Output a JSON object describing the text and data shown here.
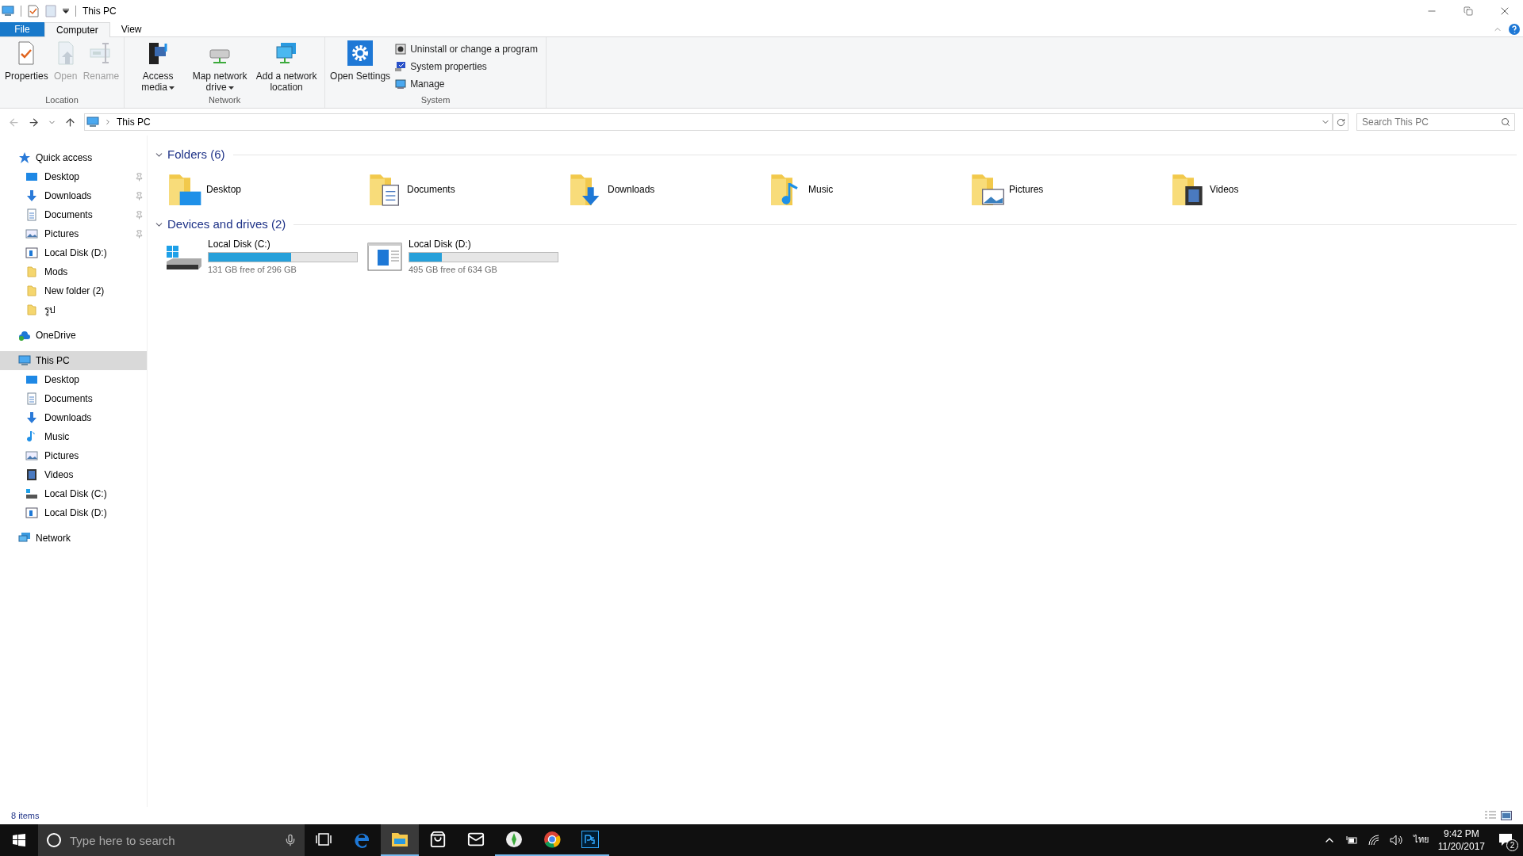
{
  "title_bar": {
    "title": "This PC"
  },
  "ribbon_tabs": [
    {
      "label": "File",
      "kind": "file",
      "selected": false
    },
    {
      "label": "Computer",
      "kind": "tab",
      "selected": true
    },
    {
      "label": "View",
      "kind": "tab",
      "selected": false
    }
  ],
  "ribbon_groups": [
    {
      "label": "Location",
      "items": [
        {
          "label": "Properties",
          "kind": "properties",
          "compact": false,
          "disabled": false,
          "dropdown": false
        },
        {
          "label": "Open",
          "kind": "open",
          "compact": false,
          "disabled": true,
          "dropdown": false
        },
        {
          "label": "Rename",
          "kind": "rename",
          "compact": false,
          "disabled": true,
          "dropdown": false
        }
      ]
    },
    {
      "label": "Network",
      "items": [
        {
          "label": "Access media",
          "kind": "media",
          "compact": false,
          "disabled": false,
          "dropdown": true
        },
        {
          "label": "Map network drive",
          "kind": "netdrive",
          "compact": false,
          "disabled": false,
          "dropdown": true
        },
        {
          "label": "Add a network location",
          "kind": "netloc",
          "compact": false,
          "disabled": false,
          "dropdown": false
        }
      ]
    },
    {
      "label": "System",
      "items": [
        {
          "label": "Open Settings",
          "kind": "settings",
          "compact": false,
          "disabled": false,
          "dropdown": false
        },
        {
          "label": "Uninstall or change a program",
          "kind": "uninstall",
          "compact": true,
          "disabled": false,
          "dropdown": false
        },
        {
          "label": "System properties",
          "kind": "sysprops",
          "compact": true,
          "disabled": false,
          "dropdown": false
        },
        {
          "label": "Manage",
          "kind": "manage",
          "compact": true,
          "disabled": false,
          "dropdown": false
        }
      ]
    }
  ],
  "address_bar": {
    "path": "This PC"
  },
  "search": {
    "placeholder": "Search This PC"
  },
  "nav_pane": [
    {
      "label": "Quick access",
      "kind": "star",
      "selected": false,
      "children": [
        {
          "label": "Desktop",
          "kind": "desktop",
          "pinned": true,
          "selected": false
        },
        {
          "label": "Downloads",
          "kind": "downloads",
          "pinned": true,
          "selected": false
        },
        {
          "label": "Documents",
          "kind": "documents",
          "pinned": true,
          "selected": false
        },
        {
          "label": "Pictures",
          "kind": "pictures",
          "pinned": true,
          "selected": false
        },
        {
          "label": "Local Disk (D:)",
          "kind": "diskd",
          "pinned": false,
          "selected": false
        },
        {
          "label": "Mods",
          "kind": "folder",
          "pinned": false,
          "selected": false
        },
        {
          "label": "New folder (2)",
          "kind": "folder",
          "pinned": false,
          "selected": false
        },
        {
          "label": "รูป",
          "kind": "folder",
          "pinned": false,
          "selected": false
        }
      ]
    },
    {
      "label": "OneDrive",
      "kind": "cloud",
      "selected": false
    },
    {
      "label": "This PC",
      "kind": "pc",
      "selected": true,
      "children": [
        {
          "label": "Desktop",
          "kind": "desktop",
          "pinned": false,
          "selected": false
        },
        {
          "label": "Documents",
          "kind": "documents",
          "pinned": false,
          "selected": false
        },
        {
          "label": "Downloads",
          "kind": "downloads",
          "pinned": false,
          "selected": false
        },
        {
          "label": "Music",
          "kind": "music",
          "pinned": false,
          "selected": false
        },
        {
          "label": "Pictures",
          "kind": "pictures",
          "pinned": false,
          "selected": false
        },
        {
          "label": "Videos",
          "kind": "videos",
          "pinned": false,
          "selected": false
        },
        {
          "label": "Local Disk (C:)",
          "kind": "diskc",
          "pinned": false,
          "selected": false
        },
        {
          "label": "Local Disk (D:)",
          "kind": "diskd",
          "pinned": false,
          "selected": false
        }
      ]
    },
    {
      "label": "Network",
      "kind": "network",
      "selected": false
    }
  ],
  "folders": {
    "title": "Folders (6)",
    "expanded": true,
    "items": [
      {
        "label": "Desktop",
        "kind": "desktop"
      },
      {
        "label": "Documents",
        "kind": "documents"
      },
      {
        "label": "Downloads",
        "kind": "downloads"
      },
      {
        "label": "Music",
        "kind": "music"
      },
      {
        "label": "Pictures",
        "kind": "pictures"
      },
      {
        "label": "Videos",
        "kind": "videos"
      }
    ]
  },
  "drives": {
    "title": "Devices and drives (2)",
    "expanded": true,
    "items": [
      {
        "label": "Local Disk (C:)",
        "kind": "diskc",
        "level": 0.557,
        "free": "131 GB free of 296 GB"
      },
      {
        "label": "Local Disk (D:)",
        "kind": "diskd",
        "level": 0.219,
        "free": "495 GB free of 634 GB"
      }
    ]
  },
  "status_bar": {
    "count": "8 items"
  },
  "taskbar": {
    "search_placeholder": "Type here to search",
    "apps": [
      {
        "kind": "taskview",
        "running": false,
        "active": false
      },
      {
        "kind": "edge",
        "running": false,
        "active": false
      },
      {
        "kind": "explorer",
        "running": true,
        "active": true
      },
      {
        "kind": "store",
        "running": false,
        "active": false
      },
      {
        "kind": "mail",
        "running": false,
        "active": false
      },
      {
        "kind": "sims",
        "running": true,
        "active": false
      },
      {
        "kind": "chrome",
        "running": true,
        "active": false
      },
      {
        "kind": "ps",
        "running": true,
        "active": false
      }
    ],
    "language": "ไทย",
    "time": "9:42 PM",
    "date": "11/20/2017",
    "notifications": "2"
  }
}
